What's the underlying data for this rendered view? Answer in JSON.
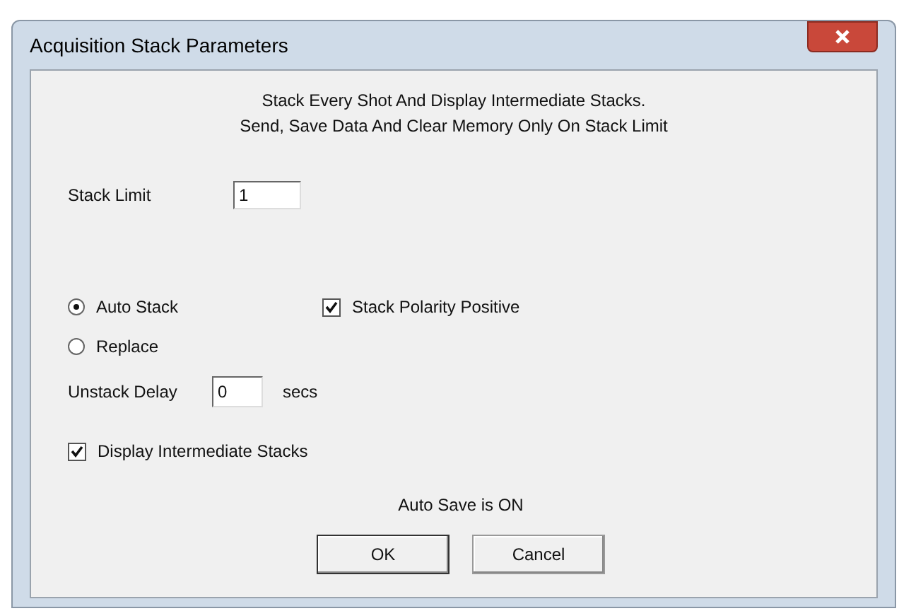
{
  "window": {
    "title": "Acquisition Stack Parameters"
  },
  "description": [
    "Stack Every Shot And Display Intermediate Stacks.",
    "Send, Save Data And Clear Memory Only On Stack Limit"
  ],
  "stack_limit": {
    "label": "Stack Limit",
    "value": "1"
  },
  "mode": [
    {
      "label": "Auto Stack",
      "selected": true
    },
    {
      "label": "Replace",
      "selected": false
    }
  ],
  "stack_polarity_positive": {
    "label": "Stack Polarity Positive",
    "checked": true
  },
  "unstack_delay": {
    "label": "Unstack Delay",
    "value": "0",
    "unit": "secs"
  },
  "display_intermediate_stacks": {
    "label": "Display Intermediate Stacks",
    "checked": true
  },
  "auto_save_status": "Auto Save is ON",
  "buttons": [
    "OK",
    "Cancel"
  ]
}
